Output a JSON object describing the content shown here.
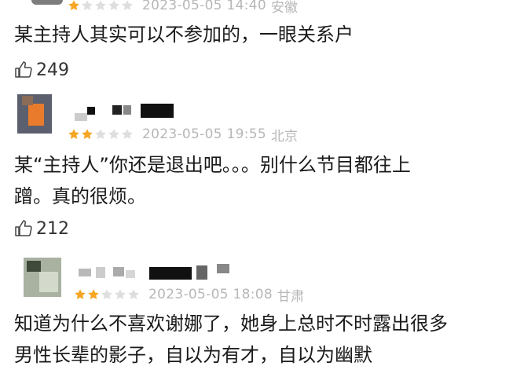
{
  "reviews": [
    {
      "date": "2023-05-05 14:40",
      "location": "安徽",
      "stars": 1,
      "lines": [
        "某主持人其实可以不参加的，一眼关系户"
      ],
      "likes": "249"
    },
    {
      "date": "2023-05-05 19:55",
      "location": "北京",
      "stars": 2,
      "lines": [
        "某“主持人”你还是退出吧。。。别什么节目都往上",
        "蹭。真的很烦。"
      ],
      "likes": "212"
    },
    {
      "date": "2023-05-05 18:08",
      "location": "甘肃",
      "stars": 2,
      "lines": [
        "知道为什么不喜欢谢娜了，她身上总时不时露出很多",
        "男性长辈的影子，自以为有才，自以为幽默"
      ]
    }
  ],
  "colors": {
    "star_filled": "#f6a623",
    "star_empty": "#dedede",
    "meta_text": "#b7b7b7"
  },
  "icons": {
    "star": "star-icon",
    "like": "thumbs-up-icon"
  }
}
